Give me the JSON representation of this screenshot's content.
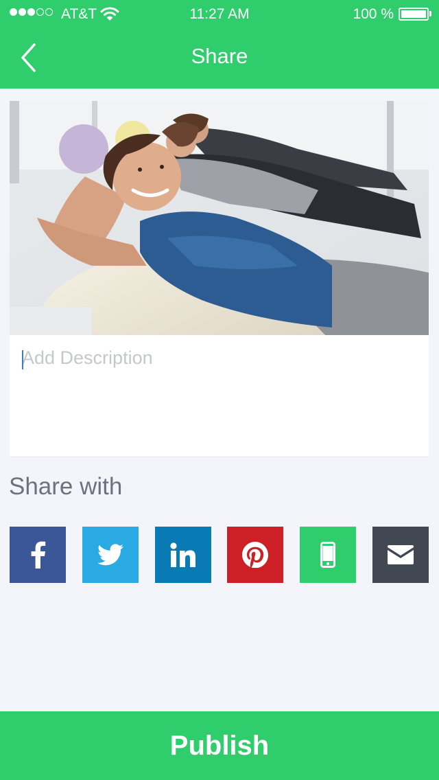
{
  "status_bar": {
    "signal": {
      "filled": 3,
      "total": 5
    },
    "carrier": "AT&T",
    "time": "11:27 AM",
    "battery_text": "100 %",
    "battery_level": 1.0
  },
  "nav": {
    "title": "Share",
    "back_icon": "chevron-left-icon"
  },
  "post": {
    "description_placeholder": "Add Description",
    "description_value": ""
  },
  "share": {
    "label": "Share with",
    "targets": [
      {
        "id": "facebook",
        "icon": "facebook-icon",
        "color": "#3b5797"
      },
      {
        "id": "twitter",
        "icon": "twitter-icon",
        "color": "#29aae2"
      },
      {
        "id": "linkedin",
        "icon": "linkedin-icon",
        "color": "#0a7ab5"
      },
      {
        "id": "pinterest",
        "icon": "pinterest-icon",
        "color": "#cc1f26"
      },
      {
        "id": "sms",
        "icon": "phone-icon",
        "color": "#2fcd6c"
      },
      {
        "id": "email",
        "icon": "envelope-icon",
        "color": "#424852"
      }
    ]
  },
  "publish": {
    "label": "Publish"
  },
  "colors": {
    "brand_green": "#2fcd6c",
    "background": "#f4f5fa"
  }
}
